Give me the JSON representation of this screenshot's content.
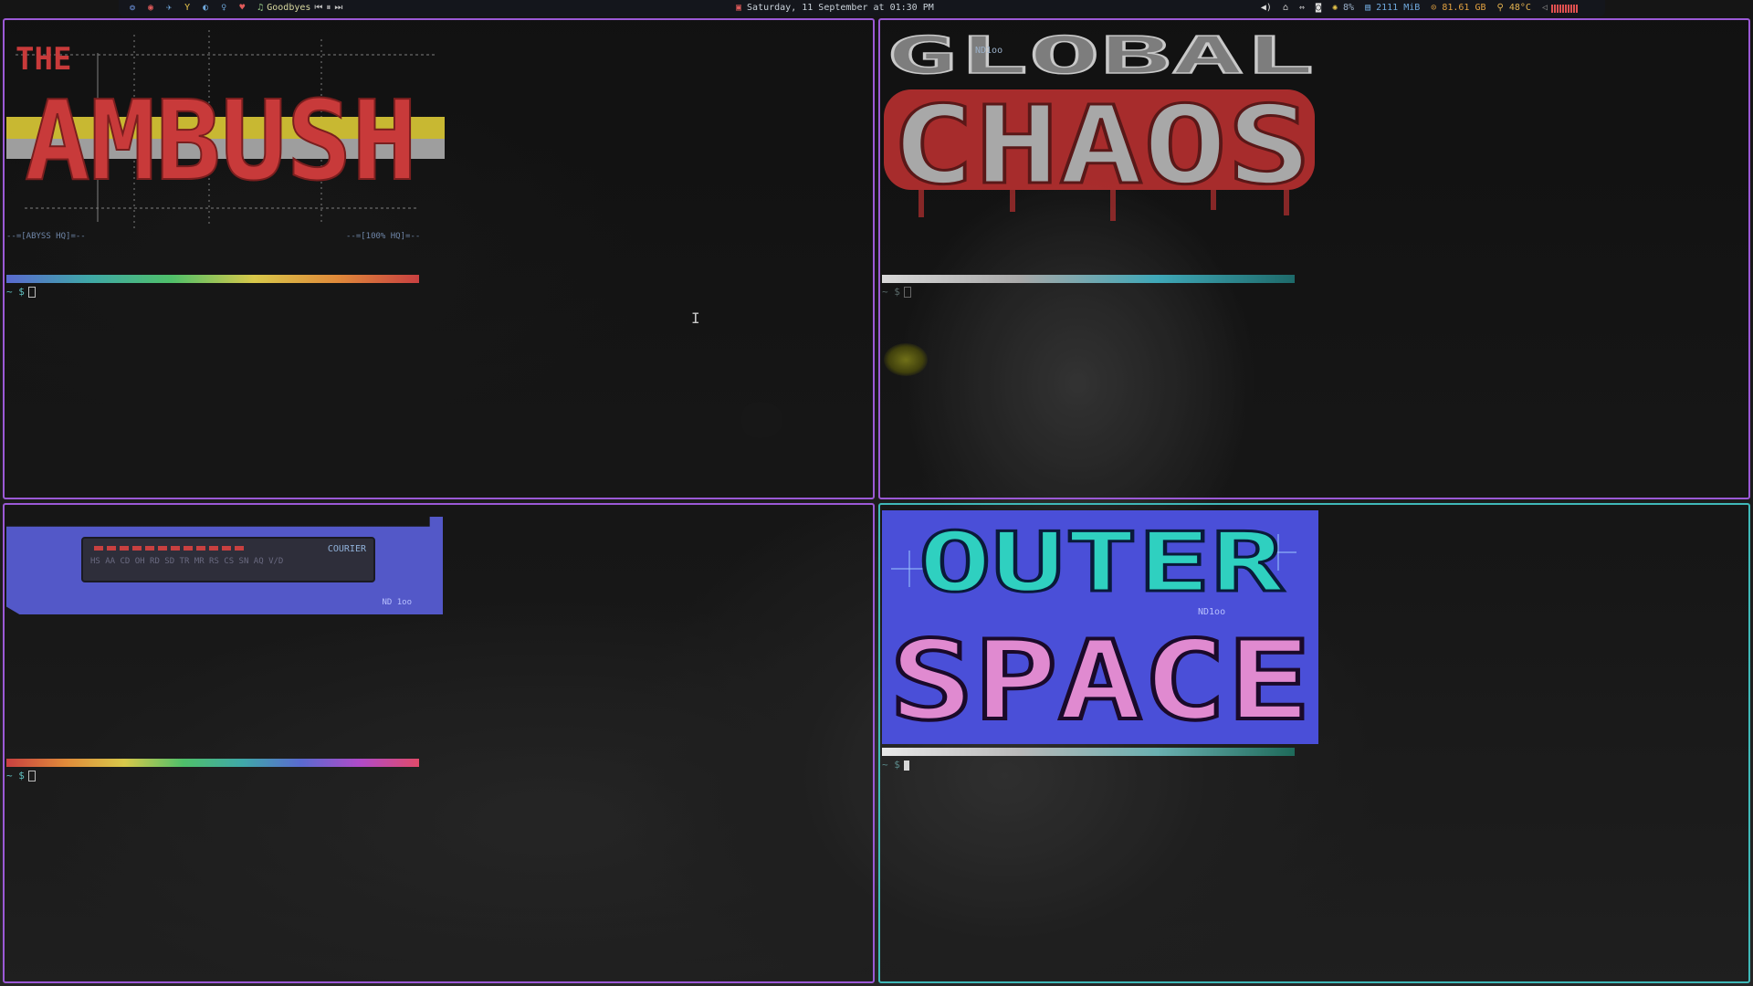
{
  "topbar": {
    "workspaces": [
      "❂",
      "◉",
      "✈",
      "Y",
      "◐",
      "♀"
    ],
    "workspace_colors": [
      "#6a8fd8",
      "#e05a5a",
      "#6fa8dc",
      "#e6c44a",
      "#6fa8dc",
      "#6fa8dc"
    ],
    "heart": "♥",
    "music_icon": "♫",
    "track": "Goodbyes",
    "prev": "⏮",
    "pause": "⏸",
    "next": "⏭",
    "date": "Saturday, 11 September at 01:30 PM",
    "volume_icon": "🔊",
    "memory": "2111 MiB",
    "disk": "81.61 GB",
    "temperature": "48°C",
    "brightness": "8%"
  },
  "panes": {
    "top_left": {
      "art_title_small": "THE",
      "art_title": "AMBUSH",
      "tag_left": "--=[ABYSS HQ]=--",
      "tag_right": "--=[100% HQ]=--",
      "prompt": "~ $"
    },
    "top_right": {
      "art_line1": "GLOBAL",
      "art_line2": "CHAOS",
      "art_sig": "ND1oo",
      "prompt": "~ $"
    },
    "bottom_left": {
      "device_label": "COURIER",
      "device_keys": "HS AA CD OH RD SD TR MR RS CS SN AQ  V/D",
      "art_sig": "ND 1oo",
      "prompt": "~ $"
    },
    "bottom_right": {
      "art_line1": "OUTER",
      "art_line2": "SPACE",
      "art_sig": "ND1oo",
      "prompt": "~ $"
    }
  },
  "colors": {
    "border_inactive": "#9b59d6",
    "border_active": "#3fb8b8",
    "ambush_red": "#c83a3a",
    "chaos_red": "#c33535",
    "outer_cyan": "#2fd0c0",
    "space_pink": "#e08ad0",
    "space_bg": "#4a4fd8"
  }
}
